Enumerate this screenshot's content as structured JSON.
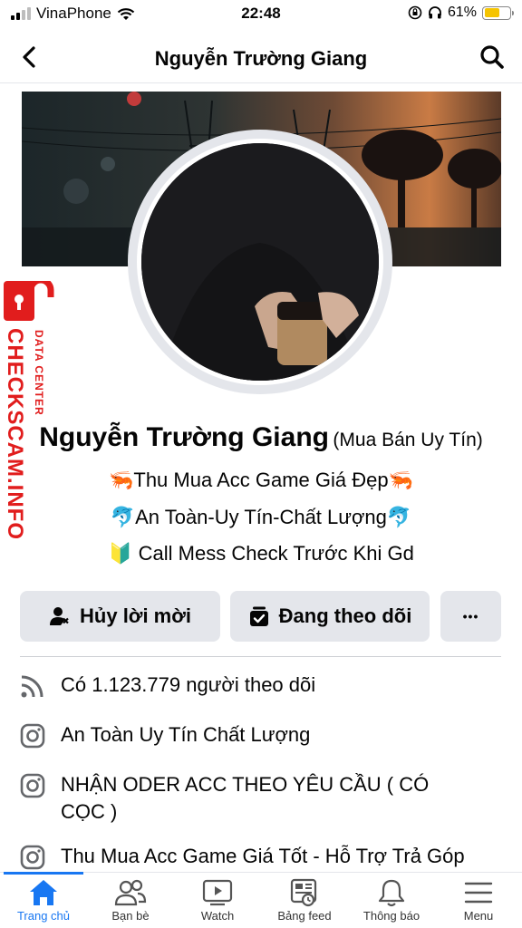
{
  "status_bar": {
    "carrier": "VinaPhone",
    "time": "22:48",
    "battery": "61%",
    "battery_level": 0.61
  },
  "header": {
    "title": "Nguyễn Trường Giang"
  },
  "watermark": {
    "main": "CHECKSCAM.INFO",
    "sub": "DATA CENTER"
  },
  "profile": {
    "name": "Nguyễn Trường Giang",
    "alternate_name": "(Mua Bán Uy Tín)",
    "bio": [
      "🦐Thu Mua Acc Game Giá Đẹp🦐",
      "🐬An Toàn-Uy Tín-Chất Lượng🐬",
      "🔰 Call Mess Check Trước Khi Gd"
    ]
  },
  "actions": {
    "cancel_request": "Hủy lời mời",
    "following": "Đang theo dõi",
    "more": "•••"
  },
  "details": [
    {
      "icon": "rss-icon",
      "text": "Có 1.123.779 người theo dõi"
    },
    {
      "icon": "instagram-icon",
      "text": "An Toàn Uy Tín Chất Lượng"
    },
    {
      "icon": "instagram-icon",
      "text": "NHẬN ODER ACC THEO YÊU CẦU ( CÓ CỌC )"
    },
    {
      "icon": "instagram-icon",
      "text": "Thu Mua Acc Game Giá Tốt - Hỗ Trợ Trả Góp"
    }
  ],
  "tabs": [
    {
      "label": "Trang chủ",
      "icon": "home-icon",
      "active": true
    },
    {
      "label": "Bạn bè",
      "icon": "friends-icon"
    },
    {
      "label": "Watch",
      "icon": "watch-icon"
    },
    {
      "label": "Bảng feed",
      "icon": "feed-icon"
    },
    {
      "label": "Thông báo",
      "icon": "bell-icon"
    },
    {
      "label": "Menu",
      "icon": "menu-icon"
    }
  ],
  "colors": {
    "accent": "#1877f2",
    "button_bg": "#e4e6eb",
    "watermark": "#e11d1d",
    "battery": "#f5c400"
  }
}
